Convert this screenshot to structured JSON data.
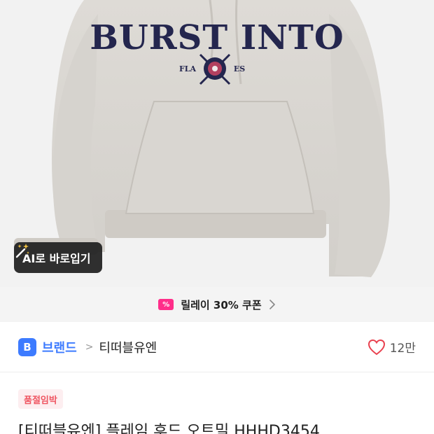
{
  "product_image": {
    "print_main": "BURST INTO",
    "print_left": "FLA",
    "print_right": "ES"
  },
  "ai_button": {
    "label": "AI로 바로입기",
    "icon": "magic-wand-icon"
  },
  "coupon": {
    "label": "릴레이 30% 쿠폰",
    "icon": "coupon-icon",
    "icon_text": "%"
  },
  "brand": {
    "badge": "B",
    "label": "브랜드",
    "separator": ">",
    "name": "티떠블유엔",
    "like_count": "12만"
  },
  "status_badge": "품절임박",
  "product_title": "[티떠블유엔] 플레임 후드 오트밀 HHHD3454",
  "colors": {
    "brand_blue": "#3d7bff",
    "coupon_pink": "#ff2e8a",
    "heart_red": "#e9414f",
    "badge_bg": "#fdeef0",
    "badge_text": "#ef5561"
  }
}
